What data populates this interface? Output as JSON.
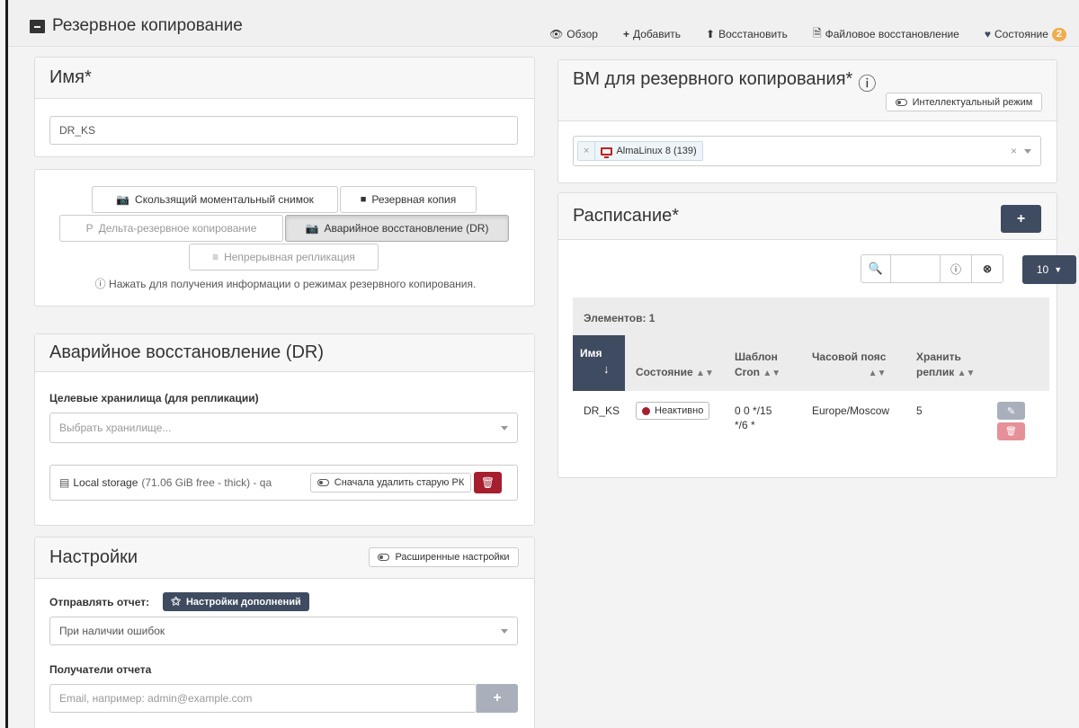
{
  "header": {
    "title": "Резервное копирование",
    "tabs": [
      {
        "icon": "eye-icon",
        "label": "Обзор"
      },
      {
        "icon": "plus-icon",
        "label": "Добавить"
      },
      {
        "icon": "upload-icon",
        "label": "Восстановить"
      },
      {
        "icon": "file-icon",
        "label": "Файловое восстановление"
      },
      {
        "icon": "heartbeat-icon",
        "label": "Состояние",
        "badge": "2"
      }
    ]
  },
  "name_panel": {
    "title": "Имя*",
    "value": "DR_KS"
  },
  "mode_panel": {
    "buttons": [
      {
        "label": "Скользящий моментальный снимок",
        "icon": "camera-icon"
      },
      {
        "label": "Резервная копия",
        "icon": "archive-icon"
      },
      {
        "label": "Дельта-резервное копирование",
        "icon": "delta-icon"
      },
      {
        "label": "Аварийное восстановление (DR)",
        "icon": "camera-icon"
      },
      {
        "label": "Непрерывная репликация",
        "icon": "continuous-icon"
      }
    ],
    "hint": "Нажать для получения информации о режимах резервного копирования."
  },
  "dr_panel": {
    "title": "Аварийное восстановление (DR)",
    "target_label": "Целевые хранилища (для репликации)",
    "target_placeholder": "Выбрать хранилище...",
    "storage_name": "Local storage",
    "storage_detail": "(71.06 GiB free - thick) - qa",
    "delete_old_label": "Сначала удалить старую РК"
  },
  "settings_panel": {
    "title": "Настройки",
    "advanced_label": "Расширенные настройки",
    "report_label": "Отправлять отчет:",
    "plugins_label": "Настройки дополнений",
    "report_value": "При наличии ошибок",
    "recipients_label": "Получатели отчета",
    "recipients_placeholder": "Email, например: admin@example.com"
  },
  "vm_panel": {
    "title": "ВМ для резервного копирования*",
    "smart_mode_label": "Интеллектуальный режим",
    "selected_vm": "AlmaLinux 8 (139)"
  },
  "schedule_panel": {
    "title": "Расписание*",
    "page_size": "10",
    "items_count": "Элементов: 1",
    "columns": {
      "name": "Имя",
      "state": "Состояние",
      "cron_1": "Шаблон",
      "cron_2": "Cron",
      "tz": "Часовой пояс",
      "keep_1": "Хранить",
      "keep_2": "реплик"
    },
    "rows": [
      {
        "name": "DR_KS",
        "state": "Неактивно",
        "cron_1": "0 0 */15",
        "cron_2": "*/6 *",
        "tz": "Europe/Moscow",
        "keep": "5"
      }
    ]
  }
}
